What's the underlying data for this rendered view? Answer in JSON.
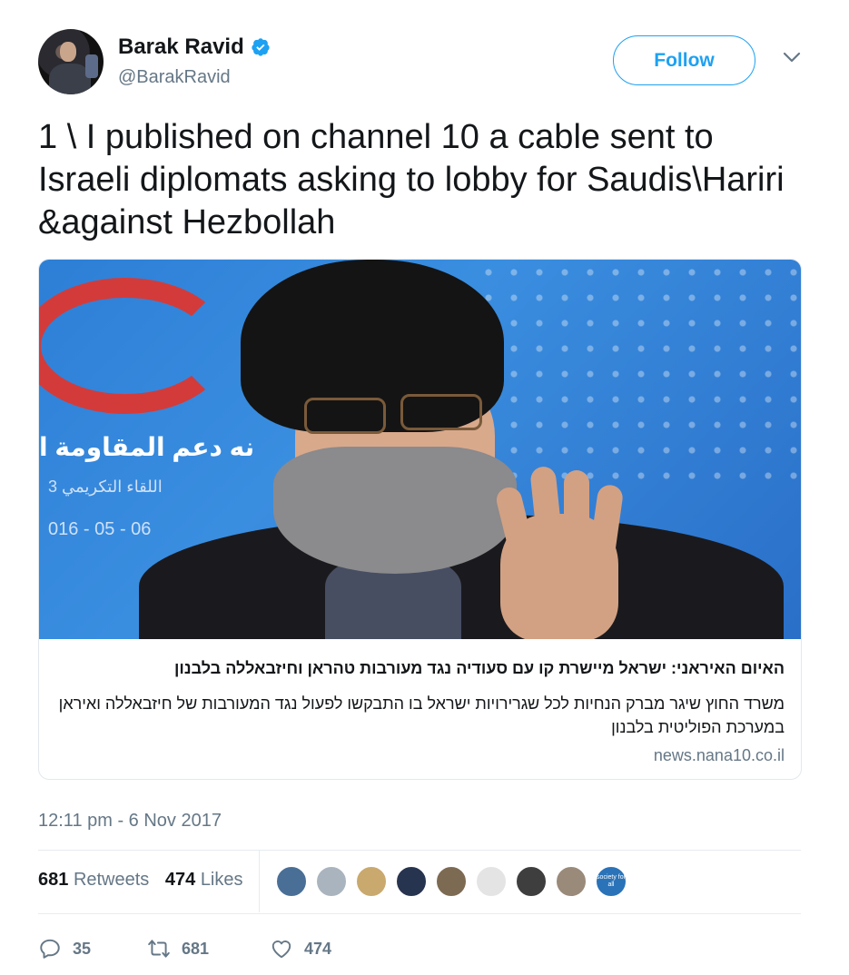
{
  "header": {
    "display_name": "Barak Ravid",
    "handle": "@BarakRavid",
    "follow_label": "Follow"
  },
  "tweet": {
    "text": "1 \\ I published on channel 10 a cable sent to Israeli diplomats asking to lobby for Saudis\\Hariri &against Hezbollah",
    "timestamp": "12:11 pm - 6 Nov 2017"
  },
  "card": {
    "title": "האיום האיראני: ישראל מיישרת קו עם סעודיה נגד מעורבות טהראן וחיזבאללה בלבנון",
    "description": "משרד החוץ שיגר מברק הנחיות לכל שגרירויות ישראל בו התבקשו לפעול נגד המעורבות של חיזבאללה ואיראן במערכת הפוליטית בלבנון",
    "domain": "news.nana10.co.il",
    "image_text": {
      "banner": "نه دعم المقاومة ا",
      "subtitle": "3 اللقاء التكريمي",
      "date": "016 - 05 - 06"
    }
  },
  "stats": {
    "retweets_count": "681",
    "retweets_label": "Retweets",
    "likes_count": "474",
    "likes_label": "Likes"
  },
  "liker_avatars": [
    {
      "color": "#4a6f96"
    },
    {
      "color": "#aab4bf"
    },
    {
      "color": "#c9a96e"
    },
    {
      "color": "#27344f"
    },
    {
      "color": "#7d6a52"
    },
    {
      "color": "#e4e4e4"
    },
    {
      "color": "#3e3e3e"
    },
    {
      "color": "#9a8a7a"
    },
    {
      "color": "#2a73b8"
    }
  ],
  "liker_badge_text": "society for all",
  "actions": {
    "replies": "35",
    "retweets": "681",
    "likes": "474"
  },
  "colors": {
    "accent": "#1da1f2",
    "muted": "#657786",
    "text": "#14171a"
  }
}
